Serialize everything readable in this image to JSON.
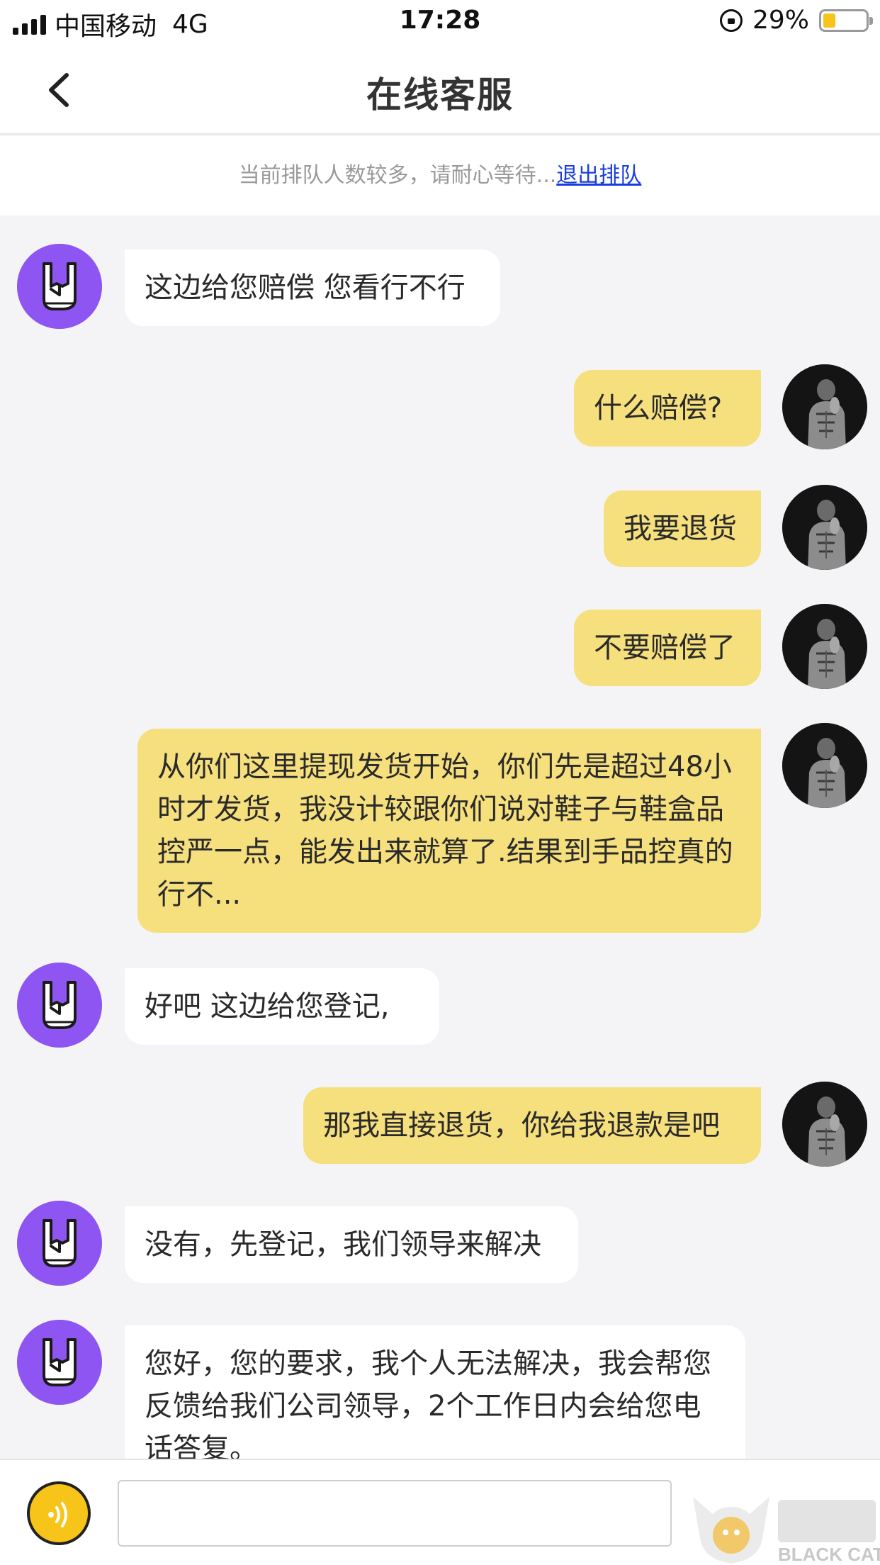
{
  "status_bar": {
    "carrier": "中国移动",
    "network": "4G",
    "time": "17:28",
    "battery": "29%",
    "battery_level": 0.29
  },
  "nav": {
    "title": "在线客服"
  },
  "queue_notice": {
    "text": "当前排队人数较多，请耐心等待...",
    "link": "退出排队"
  },
  "messages": [
    {
      "from": "agent",
      "text": "这边给您赔偿 您看行不行"
    },
    {
      "from": "user",
      "text": "什么赔偿?"
    },
    {
      "from": "user",
      "text": "我要退货"
    },
    {
      "from": "user",
      "text": "不要赔偿了"
    },
    {
      "from": "user",
      "text": "从你们这里提现发货开始，你们先是超过48小时才发货，我没计较跟你们说对鞋子与鞋盒品控严一点，能发出来就算了.结果到手品控真的行不..."
    },
    {
      "from": "agent",
      "text": "好吧 这边给您登记,"
    },
    {
      "from": "user",
      "text": "那我直接退货，你给我退款是吧"
    },
    {
      "from": "agent",
      "text": "没有，先登记，我们领导来解决"
    },
    {
      "from": "agent",
      "text": "您好，您的要求，我个人无法解决，我会帮您反馈给我们公司领导，2个工作日内会给您电话答复。"
    }
  ],
  "watermark": {
    "text": "BLACK CAT"
  },
  "colors": {
    "agent_avatar": "#8f55f2",
    "user_bubble": "#f6df7d",
    "agent_bubble": "#ffffff",
    "link": "#1a3de0",
    "voice_button": "#f7c51a"
  },
  "icons": [
    "back-chevron-icon",
    "rock-hand-icon",
    "user-photo-avatar",
    "voice-icon",
    "orientation-lock-icon",
    "battery-icon",
    "signal-icon"
  ]
}
